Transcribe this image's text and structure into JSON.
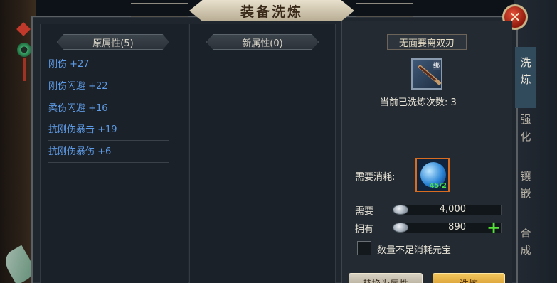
{
  "window": {
    "title": "装备洗炼",
    "close_icon": "close-icon"
  },
  "left_panel": {
    "header": "原属性(5)",
    "attributes": [
      "刚伤 +27",
      "刚伤闪避 +22",
      "柔伤闪避 +16",
      "抗刚伤暴击 +19",
      "抗刚伤暴伤 +6"
    ]
  },
  "mid_panel": {
    "header": "新属性(0)"
  },
  "right_panel": {
    "item_name": "无面要离双刃",
    "item_icon": "dual-blade-icon",
    "lock_badge": "绑",
    "wash_count_text": "当前已洗炼次数: 3",
    "cost_label": "需要消耗:",
    "cost_item_icon": "wash-stone-icon",
    "cost_item_quantity": "45/2",
    "need_label": "需要",
    "need_value": "4,000",
    "have_label": "拥有",
    "have_value": "890",
    "currency_icon": "silver-coin-icon",
    "checkbox_label": "数量不足消耗元宝",
    "checkbox_checked": false,
    "replace_button": "替换为属性",
    "wash_button": "洗炼"
  },
  "side_tabs": [
    "洗炼",
    "强化",
    "镶嵌",
    "合成"
  ],
  "colors": {
    "attribute_blue": "#5d9be6",
    "accent_orange": "#d86d22",
    "plus_green": "#56e03a"
  }
}
